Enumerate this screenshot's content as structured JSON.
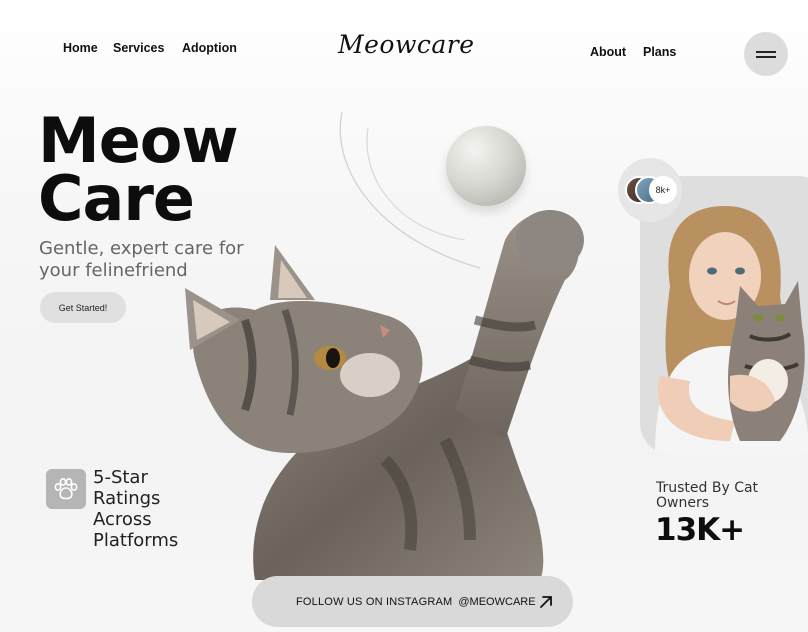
{
  "nav": {
    "left_links": [
      "Home",
      "Services",
      "Adoption"
    ],
    "logo": "Meowcare",
    "right_links": [
      "About",
      "Plans"
    ],
    "menu_icon": "hamburger-icon"
  },
  "hero": {
    "title_line1": "Meow",
    "title_line2": "Care",
    "subtitle": "Gentle, expert care for your felinefriend",
    "cta_label": "Get Started!"
  },
  "rating": {
    "icon": "paw-icon",
    "text": "5-Star Ratings Across Platforms"
  },
  "social_proof": {
    "avatar_count": "8k+",
    "trusted_label": "Trusted By Cat Owners",
    "stat": "13K+"
  },
  "footer": {
    "follow_text": "FOLLOW US ON INSTAGRAM",
    "handle": "@MEOWCARE",
    "arrow_icon": "arrow-up-right-icon"
  },
  "colors": {
    "background": "#f5f5f5",
    "pill": "#d9d9d9",
    "text_dark": "#111111",
    "text_muted": "#666666"
  }
}
